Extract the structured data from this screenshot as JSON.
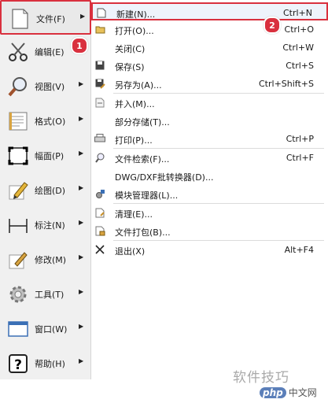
{
  "left_menu": [
    {
      "label": "文件(F)",
      "icon": "blank-page-icon"
    },
    {
      "label": "编辑(E)",
      "icon": "scissors-icon"
    },
    {
      "label": "视图(V)",
      "icon": "magnifier-icon"
    },
    {
      "label": "格式(O)",
      "icon": "format-icon"
    },
    {
      "label": "幅面(P)",
      "icon": "page-frame-icon"
    },
    {
      "label": "绘图(D)",
      "icon": "pencil-icon"
    },
    {
      "label": "标注(N)",
      "icon": "dimension-icon"
    },
    {
      "label": "修改(M)",
      "icon": "modify-icon"
    },
    {
      "label": "工具(T)",
      "icon": "gear-icon"
    },
    {
      "label": "窗口(W)",
      "icon": "window-icon"
    },
    {
      "label": "帮助(H)",
      "icon": "help-icon"
    }
  ],
  "file_menu": [
    {
      "label": "新建(N)...",
      "shortcut": "Ctrl+N",
      "icon": "new-file-icon"
    },
    {
      "label": "打开(O)...",
      "shortcut": "Ctrl+O",
      "icon": "open-folder-icon"
    },
    {
      "label": "关闭(C)",
      "shortcut": "Ctrl+W",
      "icon": ""
    },
    {
      "label": "保存(S)",
      "shortcut": "Ctrl+S",
      "icon": "save-icon"
    },
    {
      "label": "另存为(A)...",
      "shortcut": "Ctrl+Shift+S",
      "icon": "save-as-icon"
    },
    {
      "label": "并入(M)...",
      "shortcut": "",
      "icon": "merge-icon"
    },
    {
      "label": "部分存储(T)...",
      "shortcut": "",
      "icon": ""
    },
    {
      "label": "打印(P)...",
      "shortcut": "Ctrl+P",
      "icon": "printer-icon"
    },
    {
      "label": "文件检索(F)...",
      "shortcut": "Ctrl+F",
      "icon": "file-search-icon"
    },
    {
      "label": "DWG/DXF批转换器(D)...",
      "shortcut": "",
      "icon": ""
    },
    {
      "label": "模块管理器(L)...",
      "shortcut": "",
      "icon": "module-manager-icon"
    },
    {
      "label": "清理(E)...",
      "shortcut": "",
      "icon": "clean-icon"
    },
    {
      "label": "文件打包(B)...",
      "shortcut": "",
      "icon": "package-icon"
    },
    {
      "label": "退出(X)",
      "shortcut": "Alt+F4",
      "icon": "exit-icon"
    }
  ],
  "callouts": [
    "1",
    "2"
  ],
  "watermark": {
    "text": "软件技巧",
    "site": "中文网",
    "logo": "php"
  },
  "colors": {
    "callout": "#d9303e",
    "highlight_border": "#d9303e"
  }
}
